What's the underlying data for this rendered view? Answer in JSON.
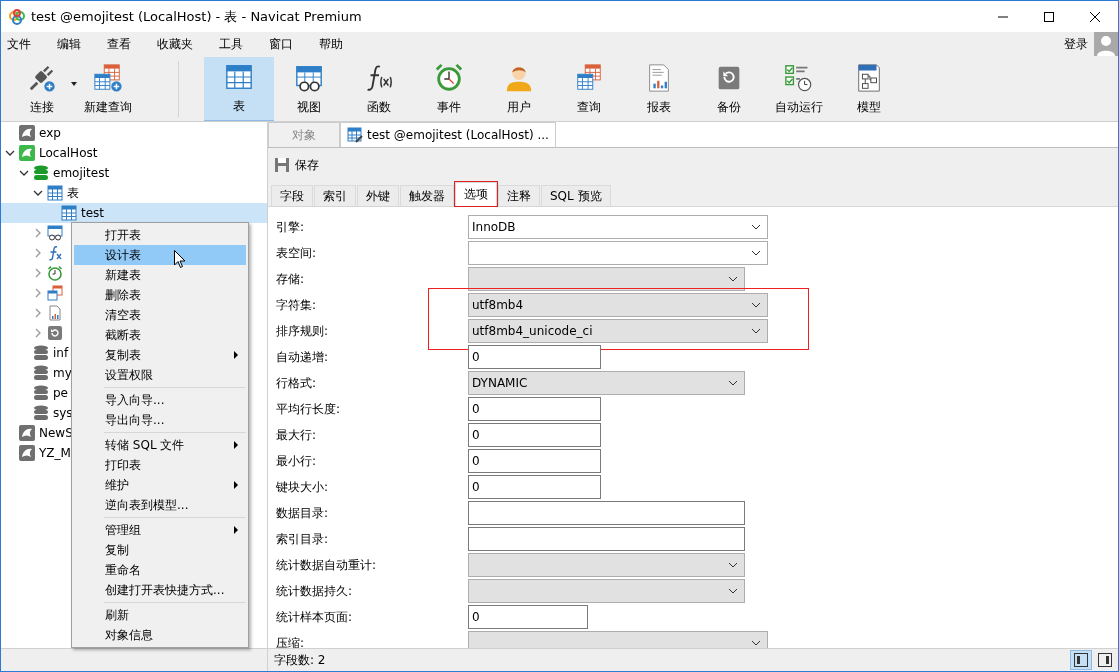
{
  "window": {
    "title": "test @emojitest (LocalHost) - 表 - Navicat Premium"
  },
  "menubar": {
    "items": [
      "文件",
      "编辑",
      "查看",
      "收藏夹",
      "工具",
      "窗口",
      "帮助"
    ],
    "login": "登录"
  },
  "toolbar": [
    {
      "kind": "connect",
      "label": "连接",
      "dropdown": true,
      "selected": false
    },
    {
      "kind": "new-query",
      "label": "新建查询",
      "dropdown": false,
      "selected": false
    },
    {
      "kind": "table",
      "label": "表",
      "dropdown": false,
      "selected": true
    },
    {
      "kind": "view",
      "label": "视图",
      "dropdown": false,
      "selected": false
    },
    {
      "kind": "function",
      "label": "函数",
      "dropdown": false,
      "selected": false
    },
    {
      "kind": "event",
      "label": "事件",
      "dropdown": false,
      "selected": false
    },
    {
      "kind": "user",
      "label": "用户",
      "dropdown": false,
      "selected": false
    },
    {
      "kind": "query",
      "label": "查询",
      "dropdown": false,
      "selected": false
    },
    {
      "kind": "report",
      "label": "报表",
      "dropdown": false,
      "selected": false
    },
    {
      "kind": "backup",
      "label": "备份",
      "dropdown": false,
      "selected": false
    },
    {
      "kind": "schedule",
      "label": "自动运行",
      "dropdown": false,
      "selected": false
    },
    {
      "kind": "model",
      "label": "模型",
      "dropdown": false,
      "selected": false
    }
  ],
  "tree": [
    {
      "kind": "connection",
      "label": "exp",
      "selected": false
    },
    {
      "kind": "connection-open",
      "label": "LocalHost",
      "expanded": true,
      "selected": false,
      "children": [
        {
          "kind": "database-open",
          "label": "emojitest",
          "expanded": true,
          "selected": false,
          "children": [
            {
              "kind": "table",
              "label": "表",
              "expanded": true,
              "selected": false,
              "children": [
                {
                  "kind": "table",
                  "label": "test",
                  "selected": true
                }
              ]
            },
            {
              "kind": "view",
              "expanded": false,
              "selected": false
            },
            {
              "kind": "function",
              "expanded": false,
              "selected": false
            },
            {
              "kind": "event",
              "expanded": false,
              "selected": false
            },
            {
              "kind": "query",
              "expanded": false,
              "selected": false
            },
            {
              "kind": "report",
              "expanded": false,
              "selected": false
            },
            {
              "kind": "backup",
              "expanded": false,
              "selected": false
            }
          ]
        },
        {
          "kind": "database",
          "label": "inf",
          "selected": false
        },
        {
          "kind": "database",
          "label": "my",
          "selected": false
        },
        {
          "kind": "database",
          "label": "pe",
          "selected": false
        },
        {
          "kind": "database",
          "label": "sys",
          "selected": false
        }
      ]
    },
    {
      "kind": "connection",
      "label": "NewS",
      "selected": false
    },
    {
      "kind": "connection",
      "label": "YZ_M",
      "selected": false
    }
  ],
  "context_menu": {
    "groups": [
      [
        {
          "label": "打开表",
          "selected": false,
          "submenu": false
        },
        {
          "label": "设计表",
          "selected": true,
          "submenu": false
        },
        {
          "label": "新建表",
          "selected": false,
          "submenu": false
        },
        {
          "label": "删除表",
          "selected": false,
          "submenu": false
        },
        {
          "label": "清空表",
          "selected": false,
          "submenu": false
        },
        {
          "label": "截断表",
          "selected": false,
          "submenu": false
        },
        {
          "label": "复制表",
          "selected": false,
          "submenu": true
        },
        {
          "label": "设置权限",
          "selected": false,
          "submenu": false
        }
      ],
      [
        {
          "label": "导入向导...",
          "selected": false,
          "submenu": false
        },
        {
          "label": "导出向导...",
          "selected": false,
          "submenu": false
        }
      ],
      [
        {
          "label": "转储 SQL 文件",
          "selected": false,
          "submenu": true
        },
        {
          "label": "打印表",
          "selected": false,
          "submenu": false
        },
        {
          "label": "维护",
          "selected": false,
          "submenu": true
        },
        {
          "label": "逆向表到模型...",
          "selected": false,
          "submenu": false
        }
      ],
      [
        {
          "label": "管理组",
          "selected": false,
          "submenu": true
        },
        {
          "label": "复制",
          "selected": false,
          "submenu": false
        },
        {
          "label": "重命名",
          "selected": false,
          "submenu": false
        },
        {
          "label": "创建打开表快捷方式...",
          "selected": false,
          "submenu": false
        }
      ],
      [
        {
          "label": "刷新",
          "selected": false,
          "submenu": false
        },
        {
          "label": "对象信息",
          "selected": false,
          "submenu": false
        }
      ]
    ]
  },
  "doc_tabs": [
    {
      "label": "对象",
      "selected": false
    },
    {
      "label": "test @emojitest (LocalHost) ...",
      "selected": true
    }
  ],
  "editor_toolbar": {
    "save": "保存"
  },
  "sub_tabs": [
    {
      "label": "字段",
      "selected": false,
      "outlined": false
    },
    {
      "label": "索引",
      "selected": false,
      "outlined": false
    },
    {
      "label": "外键",
      "selected": false,
      "outlined": false
    },
    {
      "label": "触发器",
      "selected": false,
      "outlined": false
    },
    {
      "label": "选项",
      "selected": true,
      "outlined": true
    },
    {
      "label": "注释",
      "selected": false,
      "outlined": false
    },
    {
      "label": "SQL 预览",
      "selected": false,
      "outlined": false
    }
  ],
  "options": [
    {
      "label": "引擎:",
      "kind": "select",
      "value": "InnoDB",
      "disabled": false,
      "outlined": false
    },
    {
      "label": "表空间:",
      "kind": "select",
      "disabled": false,
      "outlined": false
    },
    {
      "label": "存储:",
      "kind": "select",
      "disabled": true,
      "outlined": false
    },
    {
      "label": "字符集:",
      "kind": "select",
      "value": "utf8mb4",
      "disabled": true,
      "outlined": true
    },
    {
      "label": "排序规则:",
      "kind": "select",
      "value": "utf8mb4_unicode_ci",
      "disabled": true,
      "outlined": true
    },
    {
      "label": "自动递增:",
      "kind": "input",
      "value": "0",
      "outlined": false
    },
    {
      "label": "行格式:",
      "kind": "select",
      "value": "DYNAMIC",
      "disabled": true,
      "outlined": false
    },
    {
      "label": "平均行长度:",
      "kind": "input",
      "value": "0",
      "outlined": false
    },
    {
      "label": "最大行:",
      "kind": "input",
      "value": "0",
      "outlined": false
    },
    {
      "label": "最小行:",
      "kind": "input",
      "value": "0",
      "outlined": false
    },
    {
      "label": "键块大小:",
      "kind": "input",
      "value": "0",
      "outlined": false
    },
    {
      "label": "数据目录:",
      "kind": "input",
      "outlined": false
    },
    {
      "label": "索引目录:",
      "kind": "input",
      "outlined": false
    },
    {
      "label": "统计数据自动重计:",
      "kind": "select",
      "disabled": true,
      "outlined": false
    },
    {
      "label": "统计数据持久:",
      "kind": "select",
      "disabled": true,
      "outlined": false
    },
    {
      "label": "统计样本页面:",
      "kind": "input",
      "value": "0",
      "outlined": false
    },
    {
      "label": "压缩:",
      "kind": "select",
      "disabled": true,
      "outlined": false
    }
  ],
  "status_bar": {
    "text": "字段数: 2",
    "view_buttons": [
      {
        "kind": "left-pane",
        "selected": true
      },
      {
        "kind": "right-pane",
        "selected": false
      }
    ]
  }
}
